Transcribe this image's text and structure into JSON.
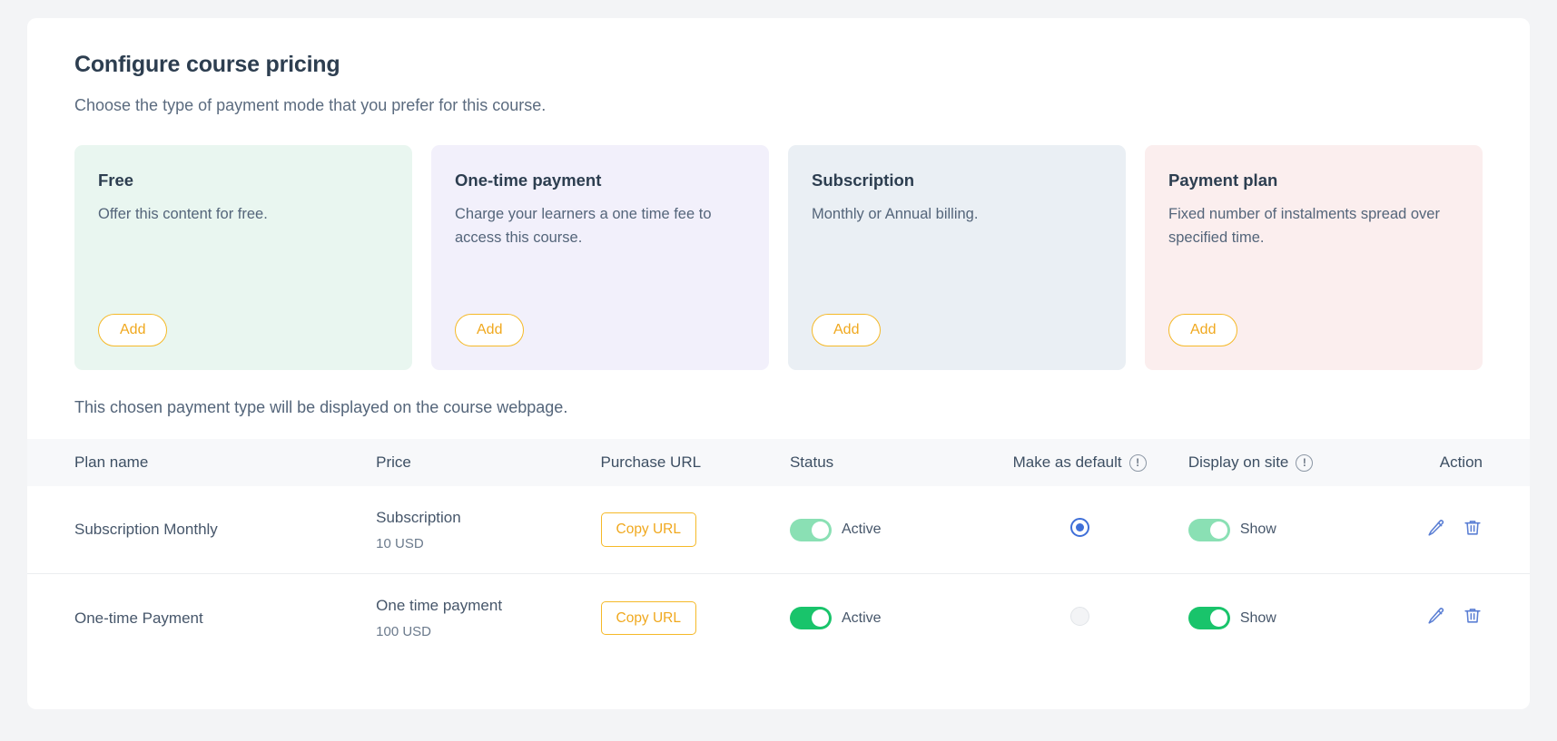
{
  "header": {
    "title": "Configure course pricing",
    "subtitle": "Choose the type of payment mode that you prefer for this course."
  },
  "cards": [
    {
      "id": "free",
      "title": "Free",
      "description": "Offer this content for free.",
      "button_label": "Add",
      "bg": "#e9f6f0"
    },
    {
      "id": "one-time-payment",
      "title": "One-time payment",
      "description": "Charge your learners a one time fee to access this course.",
      "button_label": "Add",
      "bg": "#f2f0fb"
    },
    {
      "id": "subscription",
      "title": "Subscription",
      "description": "Monthly or Annual billing.",
      "button_label": "Add",
      "bg": "#eaeff4"
    },
    {
      "id": "payment-plan",
      "title": "Payment plan",
      "description": "Fixed number of instalments spread over specified time.",
      "button_label": "Add",
      "bg": "#fbeeee"
    }
  ],
  "note": "This chosen payment type will be displayed on the course webpage.",
  "table": {
    "columns": [
      {
        "key": "plan_name",
        "label": "Plan name",
        "info": false
      },
      {
        "key": "price",
        "label": "Price",
        "info": false
      },
      {
        "key": "purchase_url",
        "label": "Purchase URL",
        "info": false
      },
      {
        "key": "status",
        "label": "Status",
        "info": false
      },
      {
        "key": "make_as_default",
        "label": "Make as default",
        "info": true,
        "info_glyph": "!"
      },
      {
        "key": "display_on_site",
        "label": "Display on site",
        "info": true,
        "info_glyph": "!"
      },
      {
        "key": "action",
        "label": "Action",
        "info": false
      }
    ],
    "rows": [
      {
        "plan_name": "Subscription Monthly",
        "price_type": "Subscription",
        "price_amount": "10 USD",
        "copy_label": "Copy URL",
        "status_label": "Active",
        "status_on": true,
        "status_tone": "light",
        "is_default": true,
        "display_label": "Show",
        "display_on": true,
        "display_tone": "light"
      },
      {
        "plan_name": "One-time Payment",
        "price_type": "One time payment",
        "price_amount": "100 USD",
        "copy_label": "Copy URL",
        "status_label": "Active",
        "status_on": true,
        "status_tone": "strong",
        "is_default": false,
        "display_label": "Show",
        "display_on": true,
        "display_tone": "strong"
      }
    ],
    "action_icons": [
      "edit-icon",
      "delete-icon"
    ]
  },
  "colors": {
    "page_background": "#f3f4f6",
    "panel_background": "#ffffff",
    "accent_amber": "#f0a81e",
    "toggle_green_strong": "#19c46b",
    "toggle_green_light": "#8ae0b4",
    "radio_blue": "#3f6fd8",
    "icon_blue": "#5b7fd4",
    "heading": "#2d3e50"
  }
}
